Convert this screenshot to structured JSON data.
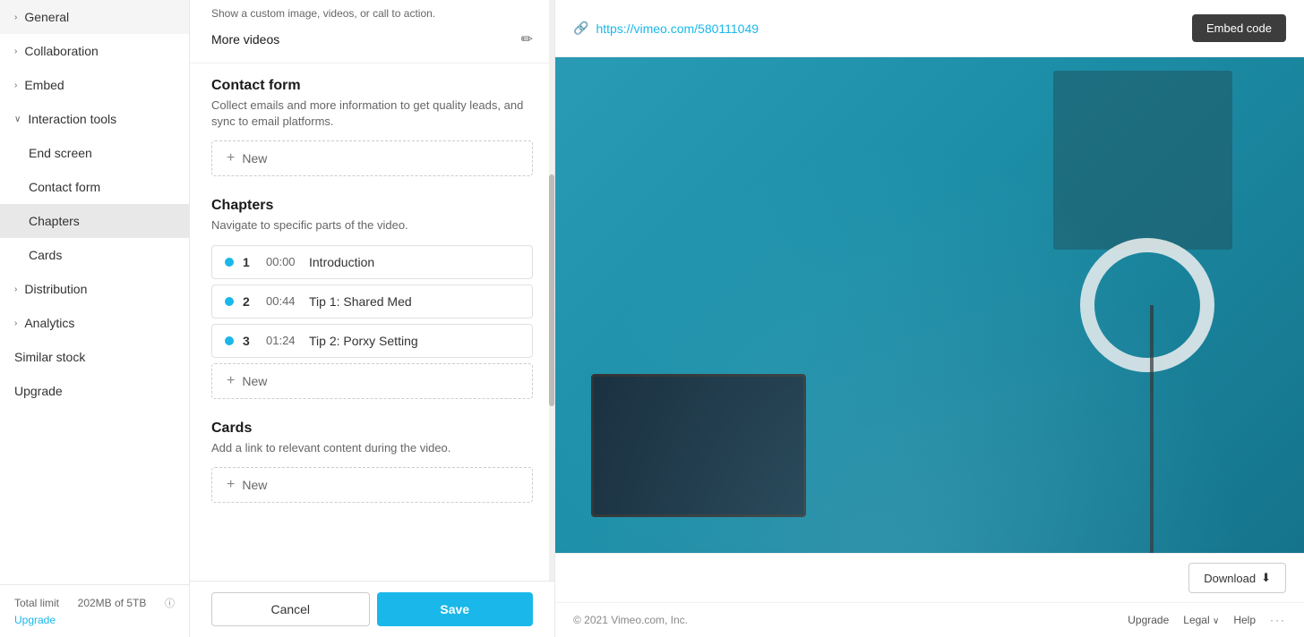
{
  "sidebar": {
    "items": [
      {
        "id": "general",
        "label": "General",
        "type": "parent",
        "expanded": false
      },
      {
        "id": "collaboration",
        "label": "Collaboration",
        "type": "parent",
        "expanded": false
      },
      {
        "id": "embed",
        "label": "Embed",
        "type": "parent",
        "expanded": false
      },
      {
        "id": "interaction-tools",
        "label": "Interaction tools",
        "type": "parent",
        "expanded": true
      },
      {
        "id": "end-screen",
        "label": "End screen",
        "type": "child"
      },
      {
        "id": "contact-form",
        "label": "Contact form",
        "type": "child"
      },
      {
        "id": "chapters",
        "label": "Chapters",
        "type": "child",
        "active": true
      },
      {
        "id": "cards",
        "label": "Cards",
        "type": "child"
      },
      {
        "id": "distribution",
        "label": "Distribution",
        "type": "parent",
        "expanded": false
      },
      {
        "id": "analytics",
        "label": "Analytics",
        "type": "parent",
        "expanded": false
      },
      {
        "id": "similar-stock",
        "label": "Similar stock",
        "type": "other"
      },
      {
        "id": "upgrade",
        "label": "Upgrade",
        "type": "other"
      }
    ],
    "footer": {
      "label": "Total limit",
      "usage": "202MB of 5TB",
      "info_icon": "ℹ",
      "upgrade_link": "Upgrade"
    }
  },
  "middle": {
    "top_section": {
      "desc": "Show a custom image, videos, or call to action.",
      "more_videos_label": "More videos"
    },
    "contact_form": {
      "title": "Contact form",
      "desc": "Collect emails and more information to get quality leads, and sync to email platforms.",
      "add_label": "New"
    },
    "chapters": {
      "title": "Chapters",
      "desc": "Navigate to specific parts of the video.",
      "items": [
        {
          "num": "1",
          "time": "00:00",
          "name": "Introduction"
        },
        {
          "num": "2",
          "time": "00:44",
          "name": "Tip 1: Shared Med"
        },
        {
          "num": "3",
          "time": "01:24",
          "name": "Tip 2: Porxy Setting"
        }
      ],
      "add_label": "New"
    },
    "cards": {
      "title": "Cards",
      "desc": "Add a link to relevant content during the video.",
      "add_label": "New"
    },
    "footer": {
      "cancel_label": "Cancel",
      "save_label": "Save"
    }
  },
  "right_panel": {
    "toolbar": {
      "url": "https://vimeo.com/580111049",
      "embed_code_label": "Embed code"
    },
    "download": {
      "label": "Download"
    },
    "footer": {
      "copyright": "© 2021 Vimeo.com, Inc.",
      "upgrade_label": "Upgrade",
      "legal_label": "Legal",
      "help_label": "Help"
    }
  }
}
